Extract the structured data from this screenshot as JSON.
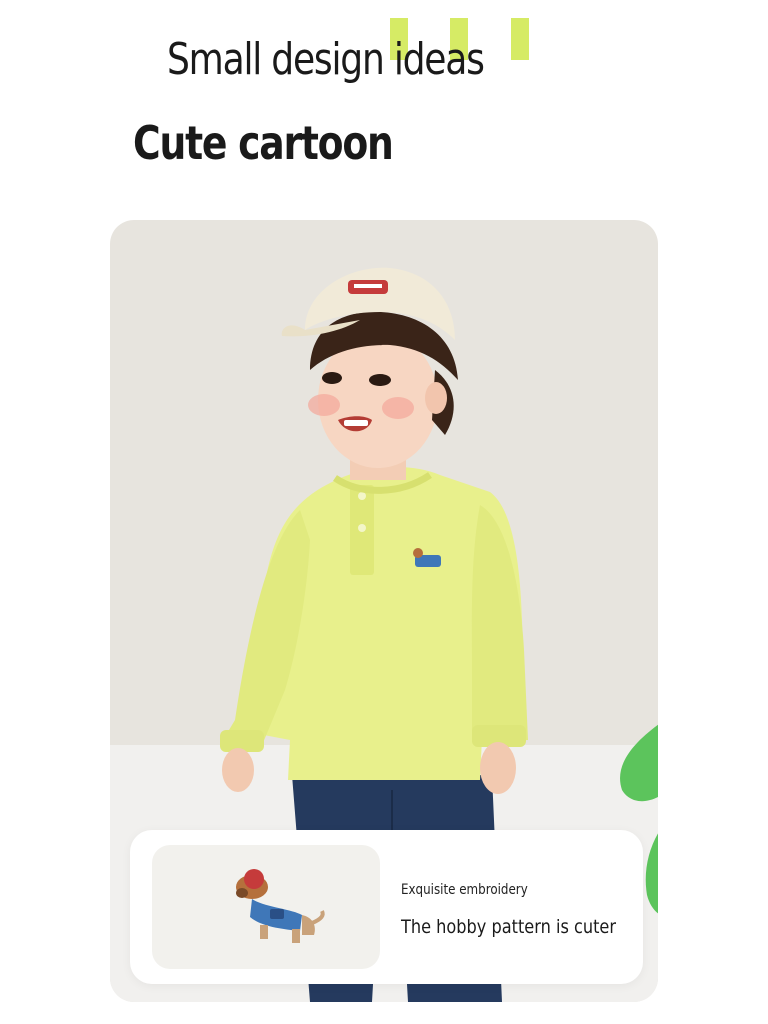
{
  "headline": "Small design ideas",
  "subheadline": "Cute cartoon",
  "info": {
    "label": "Exquisite embroidery",
    "text": "The hobby pattern is cuter"
  },
  "colors": {
    "accent": "#cfe84a",
    "shirt": "#e8f08c",
    "pants": "#253a5e",
    "cap": "#f1ead8",
    "plant": "#5cc45c",
    "background": "#e7e4de"
  },
  "icons": [
    "embroidered-dog-icon"
  ]
}
